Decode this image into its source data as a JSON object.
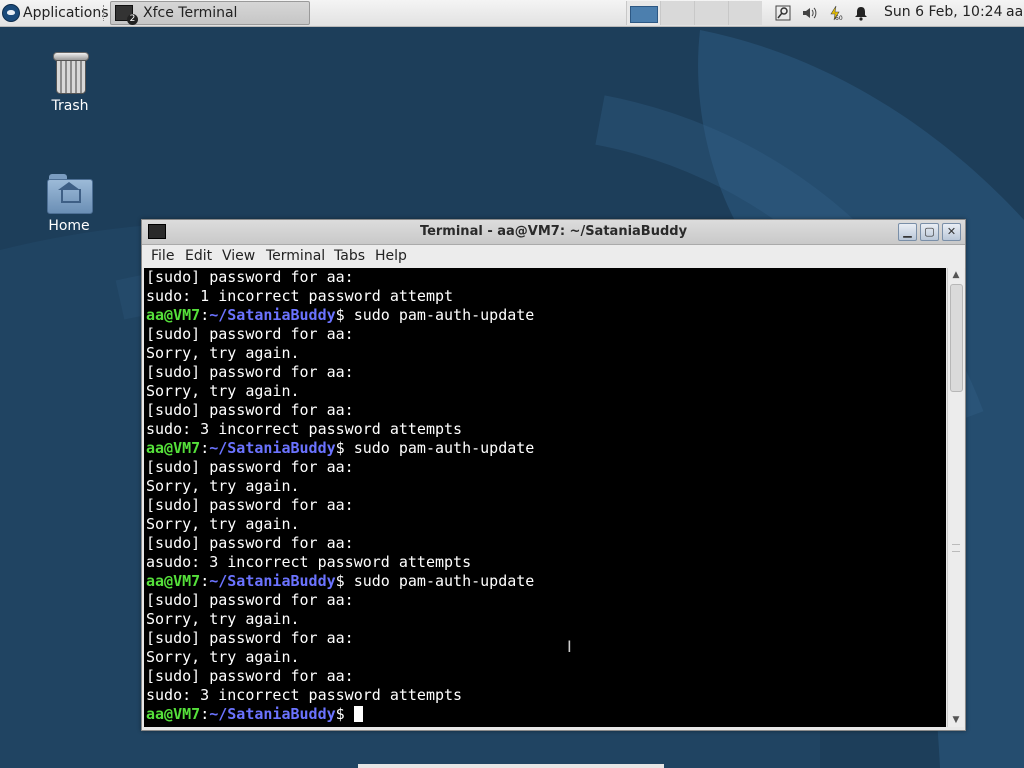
{
  "panel": {
    "applications_label": "Applications",
    "task_label": "Xfce Terminal",
    "task_badge": "2",
    "clock": "Sun  6 Feb, 10:24",
    "user": "aa"
  },
  "desktop": {
    "icons": [
      {
        "label": "Trash"
      },
      {
        "label": "Home"
      }
    ]
  },
  "window": {
    "title": "Terminal - aa@VM7: ~/SataniaBuddy",
    "menu": [
      "File",
      "Edit",
      "View",
      "Terminal",
      "Tabs",
      "Help"
    ]
  },
  "terminal": {
    "prompt_user": "aa@VM7",
    "prompt_sep": ":",
    "prompt_path": "~/SataniaBuddy",
    "prompt_end": "$ ",
    "lines": [
      {
        "type": "out",
        "text": "[sudo] password for aa:"
      },
      {
        "type": "out",
        "text": "sudo: 1 incorrect password attempt"
      },
      {
        "type": "cmd",
        "text": "sudo pam-auth-update"
      },
      {
        "type": "out",
        "text": "[sudo] password for aa:"
      },
      {
        "type": "out",
        "text": "Sorry, try again."
      },
      {
        "type": "out",
        "text": "[sudo] password for aa:"
      },
      {
        "type": "out",
        "text": "Sorry, try again."
      },
      {
        "type": "out",
        "text": "[sudo] password for aa:"
      },
      {
        "type": "out",
        "text": "sudo: 3 incorrect password attempts"
      },
      {
        "type": "cmd",
        "text": "sudo pam-auth-update"
      },
      {
        "type": "out",
        "text": "[sudo] password for aa:"
      },
      {
        "type": "out",
        "text": "Sorry, try again."
      },
      {
        "type": "out",
        "text": "[sudo] password for aa:"
      },
      {
        "type": "out",
        "text": "Sorry, try again."
      },
      {
        "type": "out",
        "text": "[sudo] password for aa:"
      },
      {
        "type": "out",
        "text": "asudo: 3 incorrect password attempts"
      },
      {
        "type": "cmd",
        "text": "sudo pam-auth-update"
      },
      {
        "type": "out",
        "text": "[sudo] password for aa:"
      },
      {
        "type": "out",
        "text": "Sorry, try again."
      },
      {
        "type": "out",
        "text": "[sudo] password for aa:"
      },
      {
        "type": "out",
        "text": "Sorry, try again."
      },
      {
        "type": "out",
        "text": "[sudo] password for aa:"
      },
      {
        "type": "out",
        "text": "sudo: 3 incorrect password attempts"
      },
      {
        "type": "cmd",
        "text": "",
        "cursor": true
      }
    ]
  },
  "colors": {
    "prompt_user": "#55e03a",
    "prompt_path": "#6b73ff",
    "terminal_bg": "#000000",
    "wallpaper": "#1d3e5a"
  }
}
